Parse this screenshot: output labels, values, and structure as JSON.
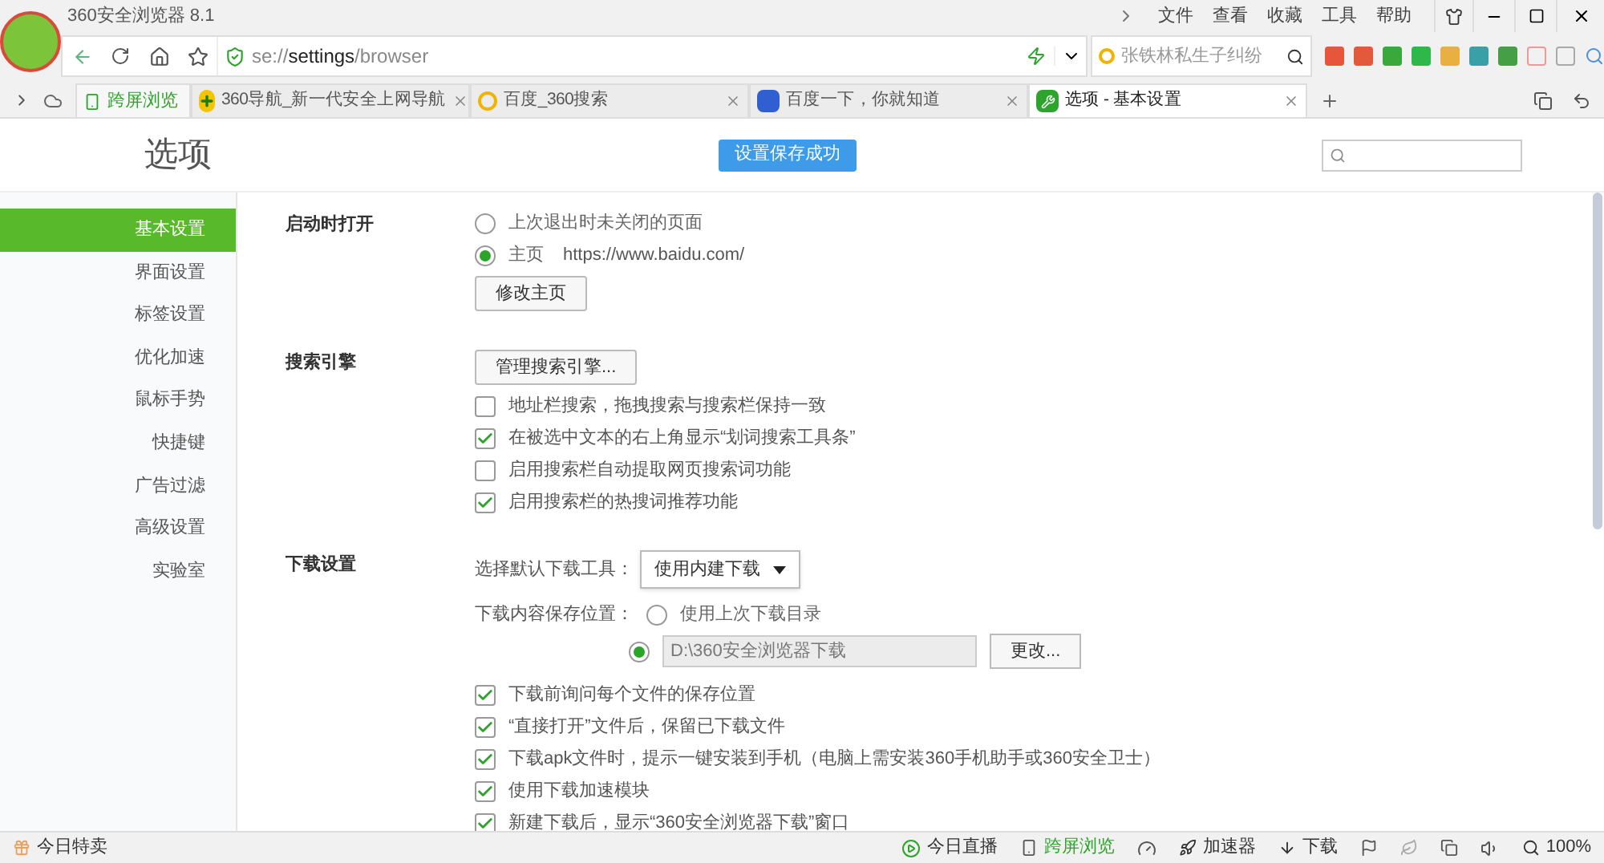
{
  "window": {
    "title": "360安全浏览器 8.1",
    "menu": [
      "文件",
      "查看",
      "收藏",
      "工具",
      "帮助"
    ]
  },
  "address_bar": {
    "url": "se://**settings**/browser",
    "search_value": "张铁林私生子纠纷"
  },
  "cross_screen": "跨屏浏览",
  "tabs": [
    {
      "label": "360导航_新一代安全上网导航",
      "selected": false
    },
    {
      "label": "百度_360搜索",
      "selected": false
    },
    {
      "label": "百度一下，你就知道",
      "selected": false
    },
    {
      "label": "选项 - 基本设置",
      "selected": true
    }
  ],
  "page": {
    "title": "选项",
    "notice": "设置保存成功"
  },
  "nav": [
    {
      "label": "基本设置",
      "selected": true
    },
    {
      "label": "界面设置",
      "selected": false
    },
    {
      "label": "标签设置",
      "selected": false
    },
    {
      "label": "优化加速",
      "selected": false
    },
    {
      "label": "鼠标手势",
      "selected": false
    },
    {
      "label": "快捷键",
      "selected": false
    },
    {
      "label": "广告过滤",
      "selected": false
    },
    {
      "label": "高级设置",
      "selected": false
    },
    {
      "label": "实验室",
      "selected": false
    }
  ],
  "sections": [
    {
      "title": "启动时打开",
      "items": [
        {
          "kind": "radio",
          "label": "上次退出时未关闭的页面",
          "selected": false
        },
        {
          "kind": "radio",
          "label": "主页",
          "url": "https://www.baidu.com/",
          "selected": true
        },
        {
          "kind": "button",
          "label": "修改主页"
        }
      ]
    },
    {
      "title": "搜索引擎",
      "items": [
        {
          "kind": "button",
          "label": "管理搜索引擎..."
        },
        {
          "kind": "checkbox",
          "label": "地址栏搜索，拖拽搜索与搜索栏保持一致",
          "checked": false
        },
        {
          "kind": "checkbox",
          "label": "在被选中文本的右上角显示“划词搜索工具条”",
          "checked": true
        },
        {
          "kind": "checkbox",
          "label": "启用搜索栏自动提取网页搜索词功能",
          "checked": false
        },
        {
          "kind": "checkbox",
          "label": "启用搜索栏的热搜词推荐功能",
          "checked": true
        }
      ]
    },
    {
      "title": "下载设置",
      "items": [
        {
          "kind": "select",
          "label": "选择默认下载工具：",
          "value": "使用内建下载"
        },
        {
          "kind": "radio",
          "label": "使用上次下载目录",
          "prefix": "下载内容保存位置：",
          "selected": false
        },
        {
          "kind": "path",
          "value": "D:\\360安全浏览器下载",
          "button": "更改...",
          "selected": true
        },
        {
          "kind": "checkbox",
          "label": "下载前询问每个文件的保存位置",
          "checked": true
        },
        {
          "kind": "checkbox",
          "label": "“直接打开”文件后，保留已下载文件",
          "checked": true
        },
        {
          "kind": "checkbox",
          "label": "下载apk文件时，提示一键安装到手机（电脑上需安装360手机助手或360安全卫士）",
          "checked": true
        },
        {
          "kind": "checkbox",
          "label": "使用下载加速模块",
          "checked": true
        },
        {
          "kind": "checkbox",
          "label": "新建下载后，显示“360安全浏览器下载”窗口",
          "checked": true
        }
      ]
    }
  ],
  "status_bar": {
    "left": "今日特卖",
    "live": "今日直播",
    "cross_screen": "跨屏浏览",
    "accelerator": "加速器",
    "download": "下载",
    "zoom": "100%"
  }
}
